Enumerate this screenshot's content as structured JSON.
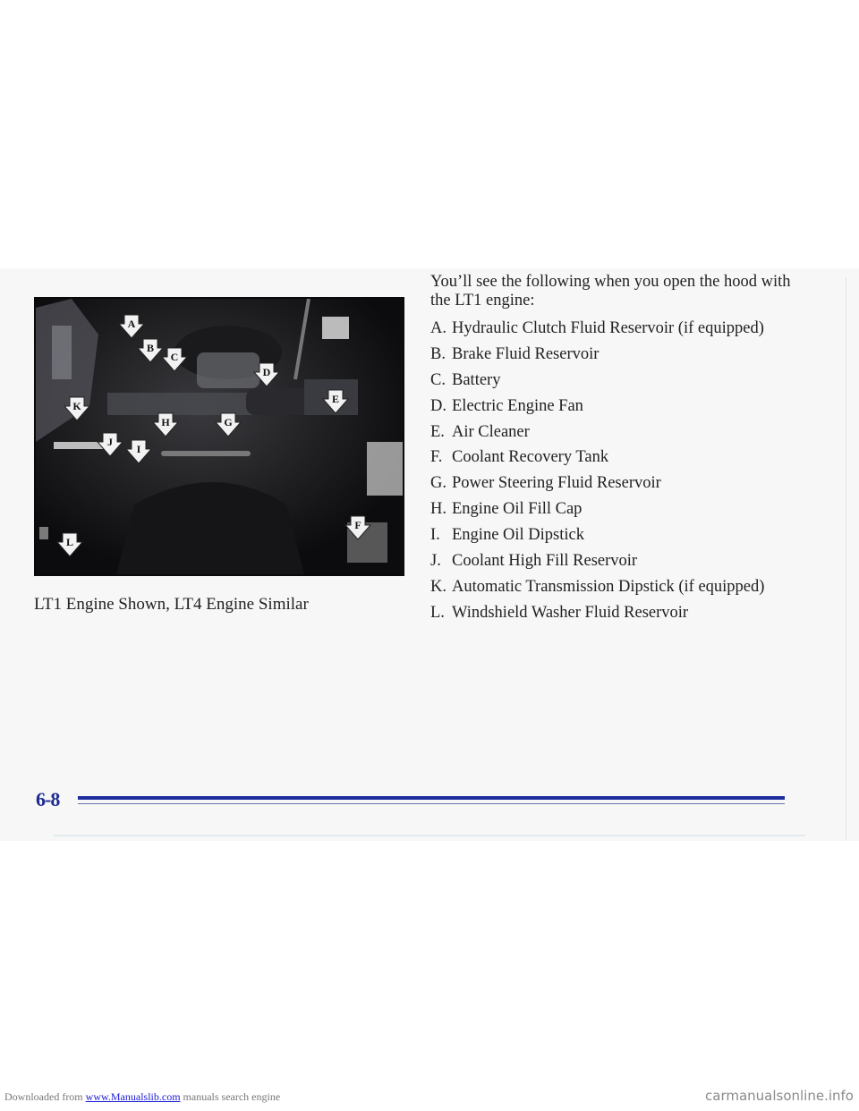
{
  "figure": {
    "description": "Engine compartment photo",
    "markers": [
      "A",
      "B",
      "C",
      "D",
      "E",
      "F",
      "G",
      "H",
      "I",
      "J",
      "K",
      "L"
    ],
    "caption": "LT1 Engine Shown, LT4 Engine Similar"
  },
  "intro": "You’ll see the following when you open the hood with the LT1 engine:",
  "items": [
    {
      "letter": "A.",
      "text": "Hydraulic Clutch Fluid Reservoir (if equipped)"
    },
    {
      "letter": "B.",
      "text": "Brake Fluid Reservoir"
    },
    {
      "letter": "C.",
      "text": "Battery"
    },
    {
      "letter": "D.",
      "text": "Electric Engine Fan"
    },
    {
      "letter": "E.",
      "text": "Air Cleaner"
    },
    {
      "letter": "F.",
      "text": "Coolant Recovery Tank"
    },
    {
      "letter": "G.",
      "text": "Power Steering Fluid Reservoir"
    },
    {
      "letter": "H.",
      "text": "Engine Oil Fill Cap"
    },
    {
      "letter": "I.",
      "text": "Engine Oil Dipstick"
    },
    {
      "letter": "J.",
      "text": "Coolant High Fill Reservoir"
    },
    {
      "letter": "K.",
      "text": "Automatic Transmission Dipstick (if equipped)"
    },
    {
      "letter": "L.",
      "text": "Windshield Washer Fluid Reservoir"
    }
  ],
  "footer": {
    "page_number": "6-8",
    "rule_color": "#1e2ea0"
  },
  "download_bar": {
    "prefix": "Downloaded from ",
    "link_text": "www.Manualslib.com",
    "suffix": " manuals search engine",
    "brand": "carmanualsonline.info"
  }
}
